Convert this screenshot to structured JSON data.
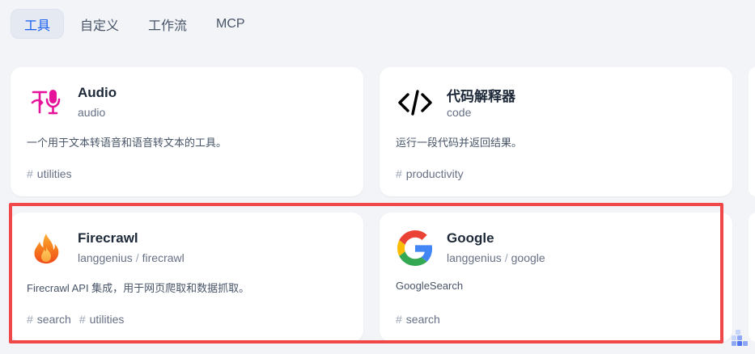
{
  "tabs": [
    {
      "label": "工具",
      "active": true
    },
    {
      "label": "自定义",
      "active": false
    },
    {
      "label": "工作流",
      "active": false
    },
    {
      "label": "MCP",
      "active": false
    }
  ],
  "cards": [
    {
      "title": "Audio",
      "subtitle": "audio",
      "description": "一个用于文本转语音和语音转文本的工具。",
      "tags": [
        "utilities"
      ],
      "icon": "audio-tts-icon"
    },
    {
      "title": "代码解释器",
      "subtitle": "code",
      "description": "运行一段代码并返回结果。",
      "tags": [
        "productivity"
      ],
      "icon": "code-brackets-icon"
    },
    {
      "title": "Firecrawl",
      "author": "langgenius",
      "separator": "/",
      "subtitle": "firecrawl",
      "description": "Firecrawl API 集成，用于网页爬取和数据抓取。",
      "tags": [
        "search",
        "utilities"
      ],
      "icon": "firecrawl-flame-icon"
    },
    {
      "title": "Google",
      "author": "langgenius",
      "separator": "/",
      "subtitle": "google",
      "description": "GoogleSearch",
      "tags": [
        "search"
      ],
      "icon": "google-logo-icon"
    }
  ],
  "tag_prefix": "#",
  "colors": {
    "background": "#f2f4f7",
    "active_tab_text": "#155eef",
    "highlight_border": "#f04848",
    "audio_icon": "#e6139a"
  }
}
